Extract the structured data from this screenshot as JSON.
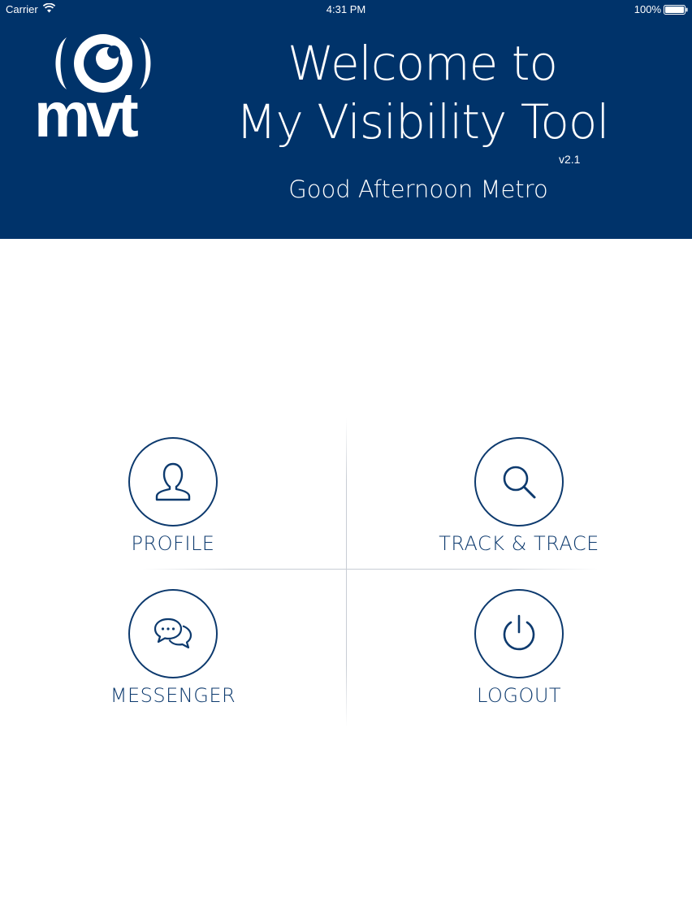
{
  "statusbar": {
    "carrier": "Carrier",
    "time": "4:31 PM",
    "battery": "100%"
  },
  "header": {
    "logo_text": "mvt",
    "welcome_line1": "Welcome to",
    "welcome_line2": "My Visibility Tool",
    "version": "v2.1",
    "greeting": "Good Afternoon Metro",
    "background_color": "#00336a"
  },
  "menu": {
    "items": [
      {
        "label": "PROFILE",
        "icon": "user-icon"
      },
      {
        "label": "TRACK & TRACE",
        "icon": "search-icon"
      },
      {
        "label": "MESSENGER",
        "icon": "chat-bubbles-icon"
      },
      {
        "label": "LOGOUT",
        "icon": "power-icon"
      }
    ],
    "accent_color": "#0d3a6e"
  }
}
